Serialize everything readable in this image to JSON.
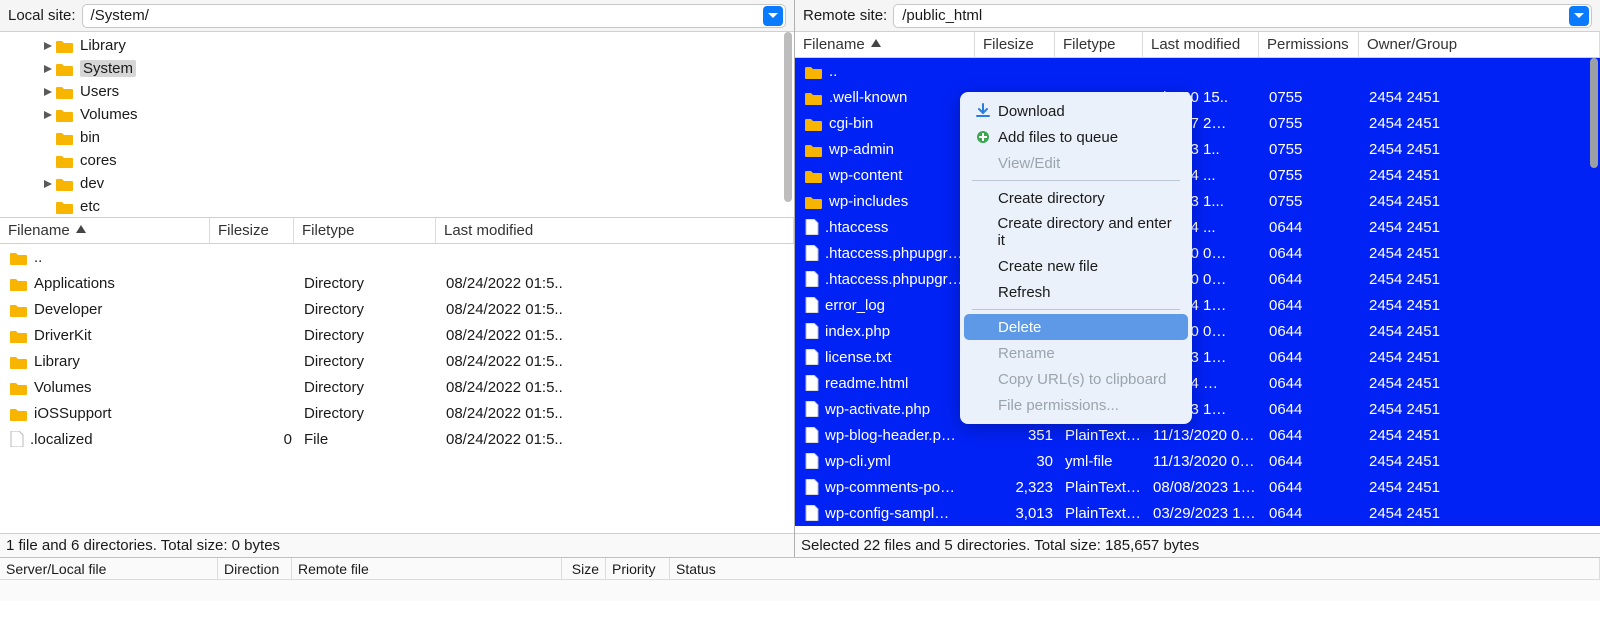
{
  "local": {
    "label": "Local site:",
    "path": "/System/",
    "tree": [
      {
        "name": "Library",
        "indent": 1,
        "expandable": true,
        "selected": false
      },
      {
        "name": "System",
        "indent": 1,
        "expandable": true,
        "selected": true
      },
      {
        "name": "Users",
        "indent": 1,
        "expandable": true,
        "selected": false
      },
      {
        "name": "Volumes",
        "indent": 1,
        "expandable": true,
        "selected": false
      },
      {
        "name": "bin",
        "indent": 1,
        "expandable": false,
        "selected": false
      },
      {
        "name": "cores",
        "indent": 1,
        "expandable": false,
        "selected": false
      },
      {
        "name": "dev",
        "indent": 1,
        "expandable": true,
        "selected": false
      },
      {
        "name": "etc",
        "indent": 1,
        "expandable": false,
        "selected": false
      }
    ],
    "columns": [
      "Filename",
      "Filesize",
      "Filetype",
      "Last modified"
    ],
    "files": [
      {
        "icon": "folder",
        "name": "..",
        "size": "",
        "type": "",
        "modified": ""
      },
      {
        "icon": "folder",
        "name": "Applications",
        "size": "",
        "type": "Directory",
        "modified": "08/24/2022 01:5.."
      },
      {
        "icon": "folder",
        "name": "Developer",
        "size": "",
        "type": "Directory",
        "modified": "08/24/2022 01:5.."
      },
      {
        "icon": "folder",
        "name": "DriverKit",
        "size": "",
        "type": "Directory",
        "modified": "08/24/2022 01:5.."
      },
      {
        "icon": "folder",
        "name": "Library",
        "size": "",
        "type": "Directory",
        "modified": "08/24/2022 01:5.."
      },
      {
        "icon": "folder",
        "name": "Volumes",
        "size": "",
        "type": "Directory",
        "modified": "08/24/2022 01:5.."
      },
      {
        "icon": "folder",
        "name": "iOSSupport",
        "size": "",
        "type": "Directory",
        "modified": "08/24/2022 01:5.."
      },
      {
        "icon": "file",
        "name": ".localized",
        "size": "0",
        "type": "File",
        "modified": "08/24/2022 01:5.."
      }
    ],
    "status": "1 file and 6 directories. Total size: 0 bytes"
  },
  "remote": {
    "label": "Remote site:",
    "path": "/public_html",
    "columns": [
      "Filename",
      "Filesize",
      "Filetype",
      "Last modified",
      "Permissions",
      "Owner/Group"
    ],
    "files": [
      {
        "icon": "folder",
        "name": "..",
        "size": "",
        "type": "",
        "modified": "",
        "perm": "",
        "owner": "",
        "selected": true
      },
      {
        "icon": "folder",
        "name": ".well-known",
        "size": "",
        "type": "",
        "modified": "2/2020 15..",
        "perm": "0755",
        "owner": "2454 2451",
        "selected": true
      },
      {
        "icon": "folder",
        "name": "cgi-bin",
        "size": "",
        "type": "",
        "modified": "2/2017 2…",
        "perm": "0755",
        "owner": "2454 2451",
        "selected": true
      },
      {
        "icon": "folder",
        "name": "wp-admin",
        "size": "",
        "type": "",
        "modified": "8/2023 1..",
        "perm": "0755",
        "owner": "2454 2451",
        "selected": true
      },
      {
        "icon": "folder",
        "name": "wp-content",
        "size": "",
        "type": "",
        "modified": "8/2024 ...",
        "perm": "0755",
        "owner": "2454 2451",
        "selected": true
      },
      {
        "icon": "folder",
        "name": "wp-includes",
        "size": "",
        "type": "",
        "modified": "7/2023 1...",
        "perm": "0755",
        "owner": "2454 2451",
        "selected": true
      },
      {
        "icon": "file",
        "name": ".htaccess",
        "size": "",
        "type": "",
        "modified": "8/2024 ...",
        "perm": "0644",
        "owner": "2454 2451",
        "selected": true
      },
      {
        "icon": "file",
        "name": ".htaccess.phpupgr…",
        "size": "",
        "type": "",
        "modified": "7/2020 0…",
        "perm": "0644",
        "owner": "2454 2451",
        "selected": true
      },
      {
        "icon": "file",
        "name": ".htaccess.phpupgr…",
        "size": "",
        "type": "",
        "modified": "7/2020 0…",
        "perm": "0644",
        "owner": "2454 2451",
        "selected": true
      },
      {
        "icon": "file",
        "name": "error_log",
        "size": "",
        "type": "",
        "modified": "7/2024 1…",
        "perm": "0644",
        "owner": "2454 2451",
        "selected": true
      },
      {
        "icon": "file",
        "name": "index.php",
        "size": "",
        "type": "",
        "modified": "1/2020 0…",
        "perm": "0644",
        "owner": "2454 2451",
        "selected": true
      },
      {
        "icon": "file",
        "name": "license.txt",
        "size": "",
        "type": "",
        "modified": "7/2023 1…",
        "perm": "0644",
        "owner": "2454 2451",
        "selected": true
      },
      {
        "icon": "file",
        "name": "readme.html",
        "size": "",
        "type": "",
        "modified": "0/2024 …",
        "perm": "0644",
        "owner": "2454 2451",
        "selected": true
      },
      {
        "icon": "file",
        "name": "wp-activate.php",
        "size": "",
        "type": "",
        "modified": "8/2023 1…",
        "perm": "0644",
        "owner": "2454 2451",
        "selected": true
      },
      {
        "icon": "file",
        "name": "wp-blog-header.p…",
        "size": "351",
        "type": "PlainTextT…",
        "modified": "11/13/2020 0…",
        "perm": "0644",
        "owner": "2454 2451",
        "selected": true
      },
      {
        "icon": "file",
        "name": "wp-cli.yml",
        "size": "30",
        "type": "yml-file",
        "modified": "11/13/2020 0…",
        "perm": "0644",
        "owner": "2454 2451",
        "selected": true
      },
      {
        "icon": "file",
        "name": "wp-comments-po…",
        "size": "2,323",
        "type": "PlainTextT…",
        "modified": "08/08/2023 1…",
        "perm": "0644",
        "owner": "2454 2451",
        "selected": true
      },
      {
        "icon": "file",
        "name": "wp-config-sampl…",
        "size": "3,013",
        "type": "PlainTextT…",
        "modified": "03/29/2023 1…",
        "perm": "0644",
        "owner": "2454 2451",
        "selected": true
      }
    ],
    "status": "Selected 22 files and 5 directories. Total size: 185,657 bytes"
  },
  "context_menu": [
    {
      "label": "Download",
      "icon": "download",
      "disabled": false,
      "hl": false
    },
    {
      "label": "Add files to queue",
      "icon": "queue",
      "disabled": false,
      "hl": false
    },
    {
      "label": "View/Edit",
      "icon": "",
      "disabled": true,
      "hl": false
    },
    {
      "sep": true
    },
    {
      "label": "Create directory",
      "disabled": false,
      "hl": false
    },
    {
      "label": "Create directory and enter it",
      "disabled": false,
      "hl": false
    },
    {
      "label": "Create new file",
      "disabled": false,
      "hl": false
    },
    {
      "label": "Refresh",
      "disabled": false,
      "hl": false
    },
    {
      "sep": true
    },
    {
      "label": "Delete",
      "disabled": false,
      "hl": true
    },
    {
      "label": "Rename",
      "disabled": true,
      "hl": false
    },
    {
      "label": "Copy URL(s) to clipboard",
      "disabled": true,
      "hl": false
    },
    {
      "label": "File permissions...",
      "disabled": true,
      "hl": false
    }
  ],
  "transfer": {
    "columns": [
      "Server/Local file",
      "Direction",
      "Remote file",
      "Size",
      "Priority",
      "Status"
    ]
  },
  "colors": {
    "selection": "#0022f5",
    "accent": "#0a7bff"
  }
}
